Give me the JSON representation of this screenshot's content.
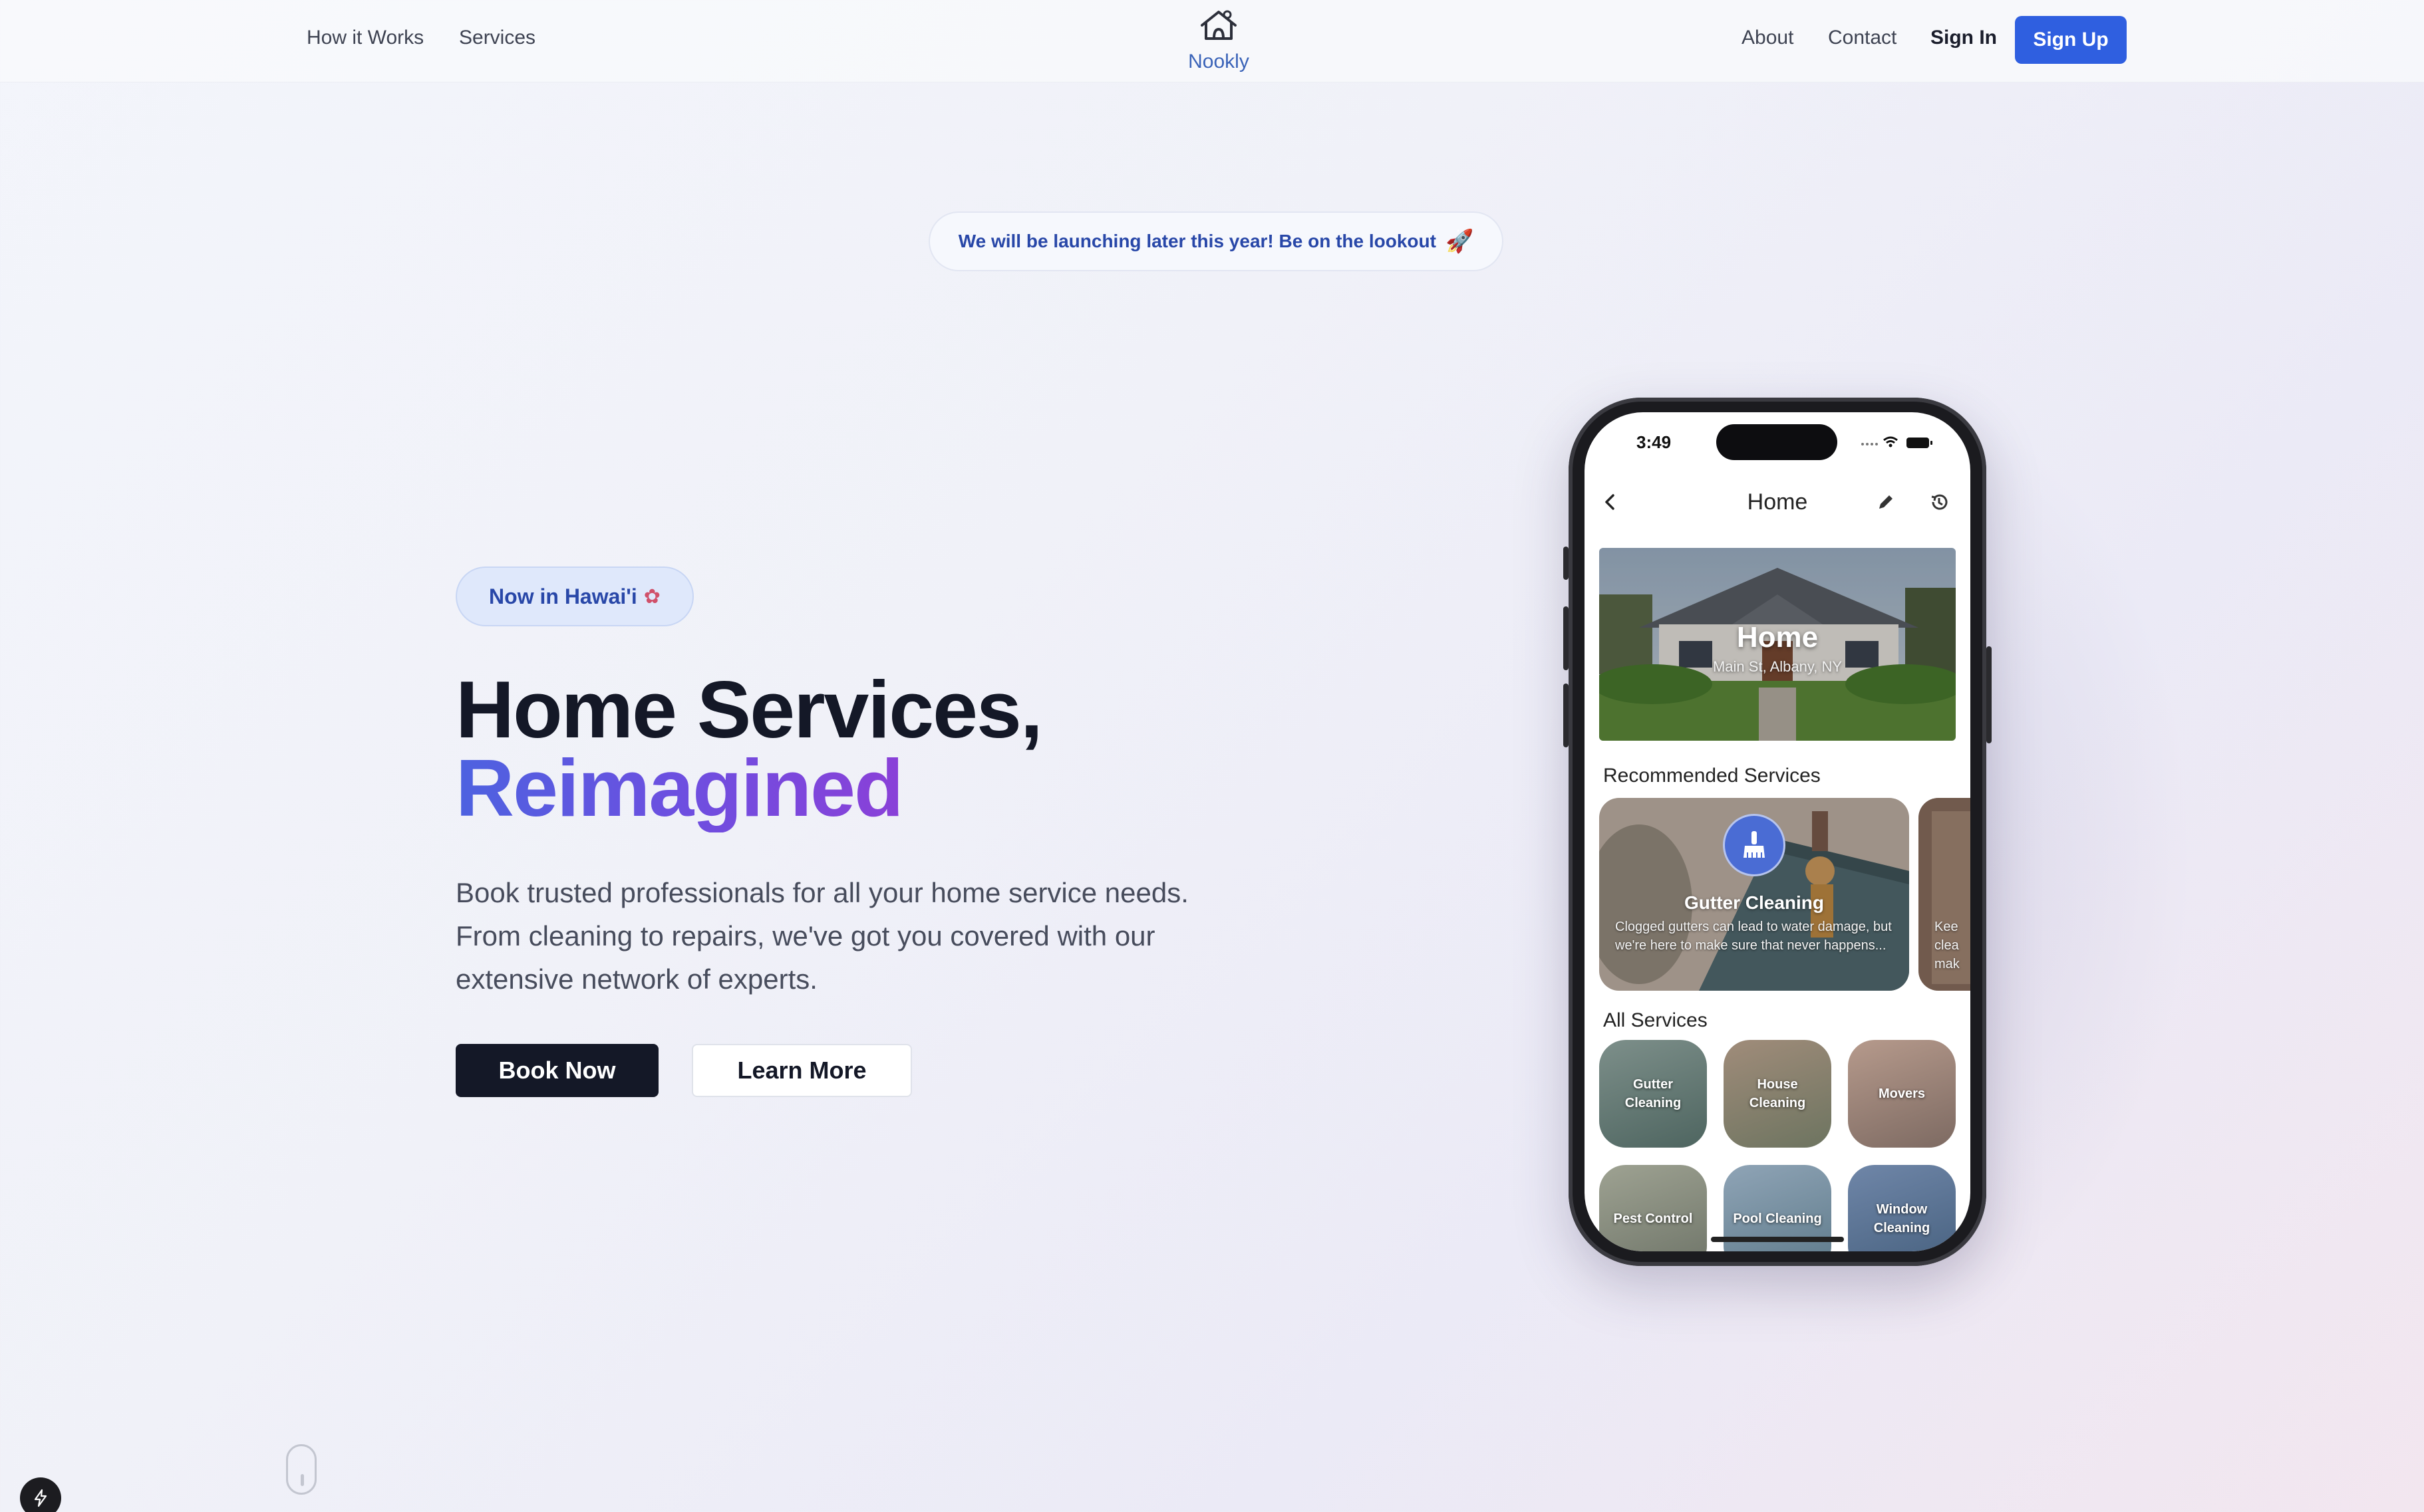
{
  "nav": {
    "left_links": [
      "How it Works",
      "Services"
    ],
    "brand": "Nookly",
    "right_links": [
      "About",
      "Contact"
    ],
    "signin": "Sign In",
    "signup": "Sign Up"
  },
  "announcement": "We will be launching later this year! Be on the lookout",
  "hero": {
    "pill": "Now in Hawai'i",
    "headline_1": "Home Services,",
    "headline_2": "Reimagined",
    "lead": "Book trusted professionals for all your home service needs. From cleaning to repairs, we've got you covered with our extensive network of experts.",
    "book": "Book Now",
    "learn": "Learn More"
  },
  "phone": {
    "time": "3:49",
    "title": "Home",
    "home_card": {
      "title": "Home",
      "address": "Main St, Albany, NY"
    },
    "recommended_label": "Recommended Services",
    "recommended": [
      {
        "title": "Gutter Cleaning",
        "desc": "Clogged gutters can lead to water damage, but we're here to make sure that never happens..."
      },
      {
        "title": "",
        "desc": "Kee clea mak"
      }
    ],
    "all_label": "All Services",
    "services": [
      "Gutter Cleaning",
      "House Cleaning",
      "Movers",
      "Pest Control",
      "Pool Cleaning",
      "Window Cleaning"
    ]
  },
  "colors": {
    "accent": "#2f5fe0",
    "dark": "#141827",
    "brand": "#3a63b8"
  }
}
